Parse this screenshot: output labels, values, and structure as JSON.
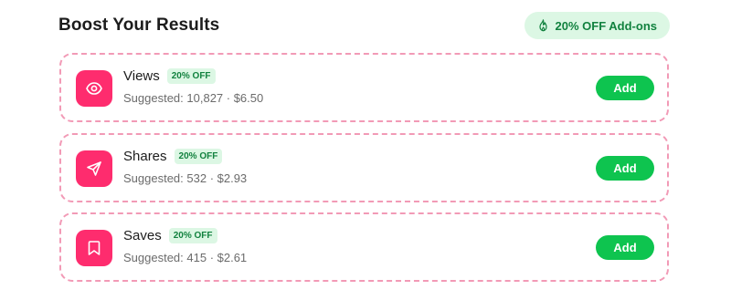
{
  "header": {
    "title": "Boost Your Results",
    "promo_label": "20% OFF Add-ons"
  },
  "colors": {
    "accent_pink": "#fe2c6e",
    "card_border": "#f29ab6",
    "add_green": "#0ec44f",
    "badge_bg": "#dcf7e4",
    "badge_text": "#12823f"
  },
  "items": [
    {
      "name": "Views",
      "badge": "20% OFF",
      "suggestion": "Suggested: 10,827 · $6.50",
      "button": "Add",
      "icon": "eye-icon"
    },
    {
      "name": "Shares",
      "badge": "20% OFF",
      "suggestion": "Suggested: 532 · $2.93",
      "button": "Add",
      "icon": "send-icon"
    },
    {
      "name": "Saves",
      "badge": "20% OFF",
      "suggestion": "Suggested: 415 · $2.61",
      "button": "Add",
      "icon": "bookmark-icon"
    }
  ]
}
